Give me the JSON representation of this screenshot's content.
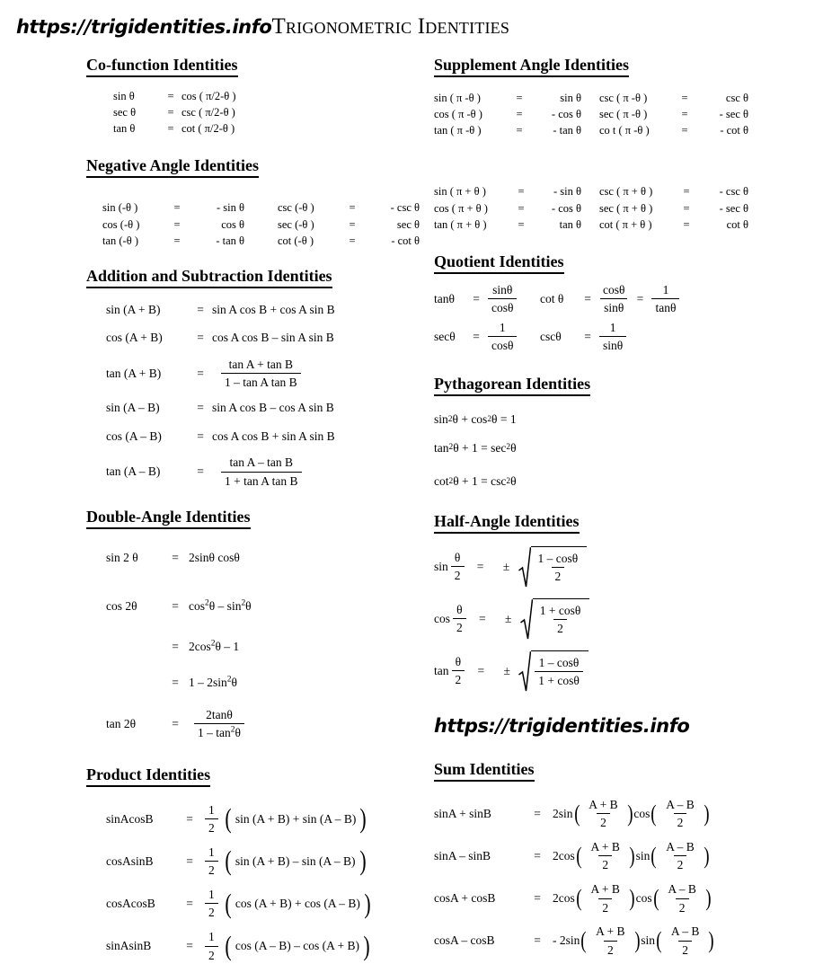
{
  "header": {
    "brand_url": "https://trigidentities.info",
    "title": "Trigonometric Identities"
  },
  "watermark": "https://trigidentities.info",
  "sections": {
    "cofunction": {
      "title": "Co-function Identities",
      "rows": [
        {
          "lhs": "sin θ",
          "eq": "=",
          "rhs": "cos ( π/2-θ )"
        },
        {
          "lhs": "sec θ",
          "eq": "=",
          "rhs": "csc ( π/2-θ )"
        },
        {
          "lhs": "tan θ",
          "eq": "=",
          "rhs": "cot ( π/2-θ )"
        }
      ]
    },
    "negative_angle": {
      "title": "Negative Angle Identities",
      "left_rows": [
        {
          "lhs": "sin (-θ )",
          "eq": "=",
          "rhs": "- sin θ"
        },
        {
          "lhs": "cos (-θ )",
          "eq": "=",
          "rhs": "cos θ"
        },
        {
          "lhs": "tan (-θ )",
          "eq": "=",
          "rhs": "- tan θ"
        }
      ],
      "right_rows": [
        {
          "lhs": "csc (-θ )",
          "eq": "=",
          "rhs": "- csc θ"
        },
        {
          "lhs": "sec (-θ )",
          "eq": "=",
          "rhs": "sec θ"
        },
        {
          "lhs": "cot (-θ )",
          "eq": "=",
          "rhs": "- cot θ"
        }
      ]
    },
    "supplement_angle": {
      "title": "Supplement Angle Identities",
      "left_rows": [
        {
          "lhs": "sin ( π -θ )",
          "eq": "=",
          "rhs": "sin θ"
        },
        {
          "lhs": "cos ( π -θ )",
          "eq": "=",
          "rhs": "- cos θ"
        },
        {
          "lhs": "tan ( π -θ )",
          "eq": "=",
          "rhs": "- tan θ"
        }
      ],
      "right_rows": [
        {
          "lhs": "csc ( π -θ )",
          "eq": "=",
          "rhs": "csc θ"
        },
        {
          "lhs": "sec ( π -θ )",
          "eq": "=",
          "rhs": "- sec θ"
        },
        {
          "lhs": "co t ( π -θ )",
          "eq": "=",
          "rhs": "- cot θ"
        }
      ]
    },
    "pi_plus_theta": {
      "left_rows": [
        {
          "lhs": "sin ( π + θ )",
          "eq": "=",
          "rhs": "- sin θ"
        },
        {
          "lhs": "cos ( π + θ )",
          "eq": "=",
          "rhs": "- cos θ"
        },
        {
          "lhs": "tan ( π + θ )",
          "eq": "=",
          "rhs": "tan θ"
        }
      ],
      "right_rows": [
        {
          "lhs": "csc ( π + θ )",
          "eq": "=",
          "rhs": "- csc θ"
        },
        {
          "lhs": "sec ( π + θ )",
          "eq": "=",
          "rhs": "- sec θ"
        },
        {
          "lhs": "cot ( π + θ )",
          "eq": "=",
          "rhs": "cot θ"
        }
      ]
    },
    "addition_subtraction": {
      "title": "Addition and Subtraction Identities",
      "rows": [
        {
          "lhs": "sin (A + B)",
          "eq": "=",
          "rhs": "sin A cos B + cos A sin B"
        },
        {
          "lhs": "cos (A + B)",
          "eq": "=",
          "rhs": "cos A cos B – sin A sin B"
        }
      ],
      "tan_add": {
        "lhs": "tan (A + B)",
        "eq": "=",
        "num": "tan A + tan B",
        "den": "1 – tan A tan B"
      },
      "rows2": [
        {
          "lhs": "sin (A – B)",
          "eq": "=",
          "rhs": "sin A cos B – cos A sin B"
        },
        {
          "lhs": "cos (A – B)",
          "eq": "=",
          "rhs": "cos A cos B + sin A sin B"
        }
      ],
      "tan_sub": {
        "lhs": "tan (A – B)",
        "eq": "=",
        "num": "tan A – tan B",
        "den": "1 + tan A tan B"
      }
    },
    "quotient": {
      "title": "Quotient Identities",
      "cells": [
        {
          "lhs": "tanθ",
          "eq": "=",
          "num": "sinθ",
          "den": "cosθ"
        },
        {
          "lhs": "cot θ",
          "eq": "=",
          "num": "cosθ",
          "den": "sinθ",
          "eq2": "=",
          "num2": "1",
          "den2": "tanθ"
        },
        {
          "lhs": "secθ",
          "eq": "=",
          "num": "1",
          "den": "cosθ"
        },
        {
          "lhs": "cscθ",
          "eq": "=",
          "num": "1",
          "den": "sinθ"
        }
      ]
    },
    "pythagorean": {
      "title": "Pythagorean Identities",
      "rows": [
        {
          "parts": [
            "sin",
            "2",
            " θ  + cos",
            "2",
            "θ  = 1"
          ]
        },
        {
          "parts": [
            "tan",
            "2",
            " θ  + 1 = sec",
            "2",
            " θ"
          ]
        },
        {
          "parts": [
            "cot",
            "2",
            "θ  + 1 = csc",
            "2",
            "θ"
          ]
        }
      ]
    },
    "double_angle": {
      "title": "Double-Angle Identities",
      "sin2": {
        "lhs": "sin 2 θ",
        "eq": "=",
        "rhs": "2sinθ   cosθ"
      },
      "cos2": {
        "lhs": "cos 2θ",
        "eq": "=",
        "pre": "cos",
        "sup1": "2",
        "mid": "θ  – sin",
        "sup2": "2",
        "post": "θ"
      },
      "cos2b": {
        "lhs": "",
        "eq": "=",
        "pre": "2cos",
        "sup1": "2",
        "mid": "θ  – 1",
        "sup2": "",
        "post": ""
      },
      "cos2c": {
        "lhs": "",
        "eq": "=",
        "pre": "1 – 2sin",
        "sup1": "2",
        "mid": "θ",
        "sup2": "",
        "post": ""
      },
      "tan2": {
        "lhs": "tan 2θ",
        "eq": "=",
        "num": "2tanθ",
        "den_pre": "1 – tan",
        "den_sup": "2",
        "den_post": "θ"
      }
    },
    "half_angle": {
      "title": "Half-Angle Identities",
      "rows": [
        {
          "fn": "sin",
          "num": "θ",
          "den": "2",
          "eq": "=",
          "pm": "±",
          "rnum": "1 – cosθ",
          "rden": "2"
        },
        {
          "fn": "cos",
          "num": "θ",
          "den": "2",
          "eq": "=",
          "pm": "±",
          "rnum": "1 + cosθ",
          "rden": "2"
        },
        {
          "fn": "tan",
          "num": "θ",
          "den": "2",
          "eq": "=",
          "pm": "±",
          "rnum": "1 – cosθ",
          "rden": "1 + cosθ"
        }
      ]
    },
    "product": {
      "title": "Product Identities",
      "rows": [
        {
          "lhs": "sinAcosB",
          "eq": "=",
          "num": "1",
          "den": "2",
          "body": "sin (A + B) + sin (A – B)"
        },
        {
          "lhs": "cosAsinB",
          "eq": "=",
          "num": "1",
          "den": "2",
          "body": "sin (A + B) – sin (A – B)"
        },
        {
          "lhs": "cosAcosB",
          "eq": "=",
          "num": "1",
          "den": "2",
          "body": "cos (A + B) + cos (A – B)"
        },
        {
          "lhs": "sinAsinB",
          "eq": "=",
          "num": "1",
          "den": "2",
          "body": "cos (A – B) – cos (A + B)"
        }
      ]
    },
    "sum": {
      "title": "Sum Identities",
      "rows": [
        {
          "lhs": "sinA + sinB",
          "eq": "=",
          "coef1": "2sin",
          "f1num": "A + B",
          "f1den": "2",
          "coef2": "cos",
          "f2num": "A – B",
          "f2den": "2"
        },
        {
          "lhs": "sinA – sinB",
          "eq": "=",
          "coef1": "2cos",
          "f1num": "A + B",
          "f1den": "2",
          "coef2": "sin",
          "f2num": "A – B",
          "f2den": "2"
        },
        {
          "lhs": "cosA + cosB",
          "eq": "=",
          "coef1": "2cos",
          "f1num": "A + B",
          "f1den": "2",
          "coef2": "cos",
          "f2num": "A – B",
          "f2den": "2"
        },
        {
          "lhs": "cosA – cosB",
          "eq": "=",
          "coef1": "- 2sin",
          "f1num": "A + B",
          "f1den": "2",
          "coef2": "sin",
          "f2num": "A – B",
          "f2den": "2"
        }
      ]
    }
  }
}
